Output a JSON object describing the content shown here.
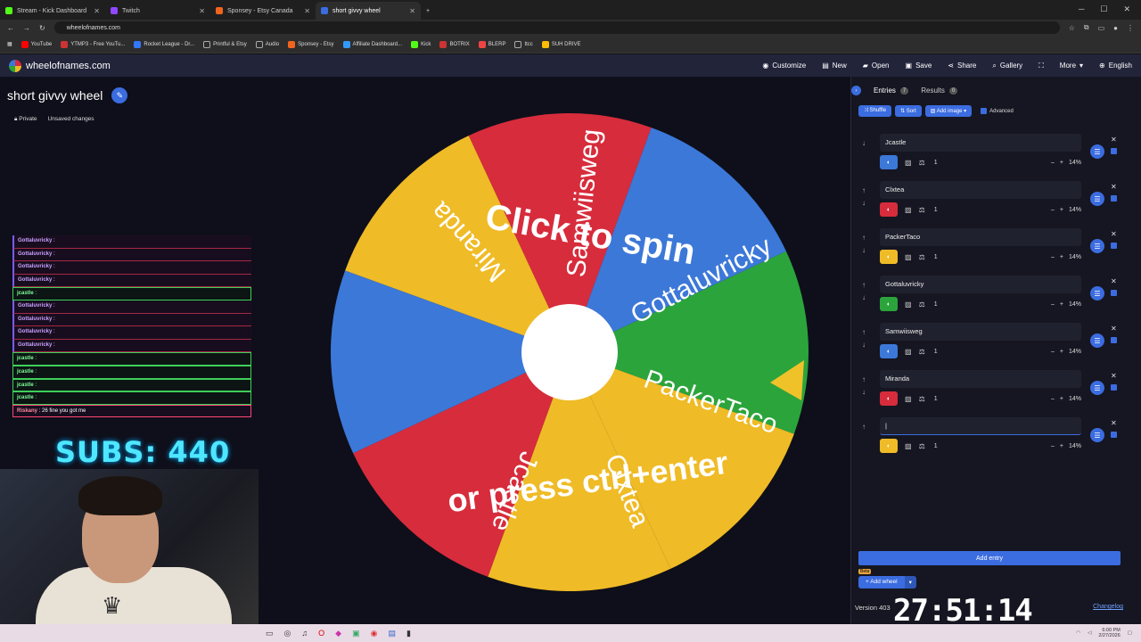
{
  "browser": {
    "tabs": [
      {
        "label": "Stream - Kick Dashboard",
        "color": "#53fc18"
      },
      {
        "label": "Twitch",
        "color": "#9146ff"
      },
      {
        "label": "Sponsey - Etsy Canada",
        "color": "#f1641e"
      },
      {
        "label": "short givvy wheel",
        "color": "#3b6ce0"
      }
    ],
    "url": "wheelofnames.com",
    "bookmarks": [
      "YouTube",
      "YTMP3 - Free YouTu...",
      "Rocket League - Dr...",
      "Printful & Etsy",
      "Audio",
      "Sponsey - Etsy",
      "Affiliate Dashboard...",
      "Kick",
      "BOTRIX",
      "BLERP",
      "ttcc",
      "SUH DRIVE"
    ]
  },
  "header": {
    "logo": "wheelofnames.com",
    "menu": [
      "Customize",
      "New",
      "Open",
      "Save",
      "Share",
      "Gallery",
      "",
      "More",
      "English"
    ]
  },
  "wheel": {
    "title": "short givvy wheel",
    "visibility": "Private",
    "save_status": "Unsaved changes",
    "prompt_line1": "Click to spin",
    "prompt_line2": "or press ctrl+enter",
    "segments": [
      "Jcastle",
      "Clxtea",
      "PackerTaco",
      "Gottaluvricky",
      "Samwiisweg",
      "Miranda"
    ],
    "colors": {
      "blue": "#3c78d8",
      "red": "#d72c3c",
      "yellow": "#efbb26",
      "green": "#2ca43c"
    }
  },
  "overlay": {
    "chat": [
      {
        "user": "Gottaluvricky",
        "msg": ""
      },
      {
        "user": "Gottaluvricky",
        "msg": ""
      },
      {
        "user": "Gottaluvricky",
        "msg": ""
      },
      {
        "user": "Gottaluvricky",
        "msg": ""
      },
      {
        "user": "jcastle",
        "msg": ""
      },
      {
        "user": "Gottaluvricky",
        "msg": ""
      },
      {
        "user": "Gottaluvricky",
        "msg": ""
      },
      {
        "user": "Gottaluvricky",
        "msg": ""
      },
      {
        "user": "Gottaluvricky",
        "msg": ""
      },
      {
        "user": "jcastle",
        "msg": ""
      },
      {
        "user": "jcastle",
        "msg": ""
      },
      {
        "user": "jcastle",
        "msg": ""
      },
      {
        "user": "jcastle",
        "msg": ""
      },
      {
        "user": "Riskany",
        "msg": "26 fine you got me"
      }
    ],
    "subs": "SUBS: 440",
    "timer": "27:51:14"
  },
  "panel": {
    "tab_entries": "Entries",
    "entries_count": "7",
    "tab_results": "Results",
    "results_count": "0",
    "shuffle": "Shuffle",
    "sort": "Sort",
    "add_image": "Add image",
    "advanced": "Advanced",
    "entries": [
      {
        "name": "Jcastle",
        "weight": "1",
        "percent": "14%",
        "color": "#3c78d8"
      },
      {
        "name": "Clxtea",
        "weight": "1",
        "percent": "14%",
        "color": "#d72c3c"
      },
      {
        "name": "PackerTaco",
        "weight": "1",
        "percent": "14%",
        "color": "#efbb26"
      },
      {
        "name": "Gottaluvricky",
        "weight": "1",
        "percent": "14%",
        "color": "#2ca43c"
      },
      {
        "name": "Samwiisweg",
        "weight": "1",
        "percent": "14%",
        "color": "#3c78d8"
      },
      {
        "name": "Miranda",
        "weight": "1",
        "percent": "14%",
        "color": "#d72c3c"
      },
      {
        "name": "",
        "weight": "1",
        "percent": "14%",
        "color": "#efbb26"
      }
    ],
    "add_entry": "Add entry",
    "add_wheel": "Add wheel",
    "beta": "Beta",
    "version": "Version 403",
    "changelog": "Changelog"
  },
  "taskbar": {
    "time": "6:00 PM",
    "date": "2/27/2026"
  }
}
